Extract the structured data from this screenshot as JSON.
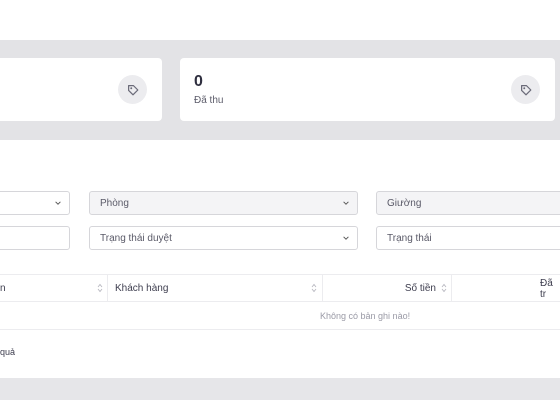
{
  "stats": [
    {
      "value": "",
      "label": "",
      "icon": "tag-icon"
    },
    {
      "value": "0",
      "label": "Đã thu",
      "icon": "tag-icon"
    }
  ],
  "filters": {
    "row1": [
      {
        "label": "",
        "type": "select"
      },
      {
        "label": "Phòng",
        "type": "select"
      },
      {
        "label": "Giường",
        "type": "select"
      }
    ],
    "row2": [
      {
        "label": "",
        "type": "input"
      },
      {
        "label": "Trạng thái duyệt",
        "type": "select"
      },
      {
        "label": "Trạng thái",
        "type": "select"
      }
    ]
  },
  "table": {
    "columns": [
      "n",
      "Khách hàng",
      "Số tiền",
      "Đã tr"
    ],
    "empty_message": "Không có bản ghi nào!"
  },
  "footer": {
    "result_text": "quả"
  }
}
